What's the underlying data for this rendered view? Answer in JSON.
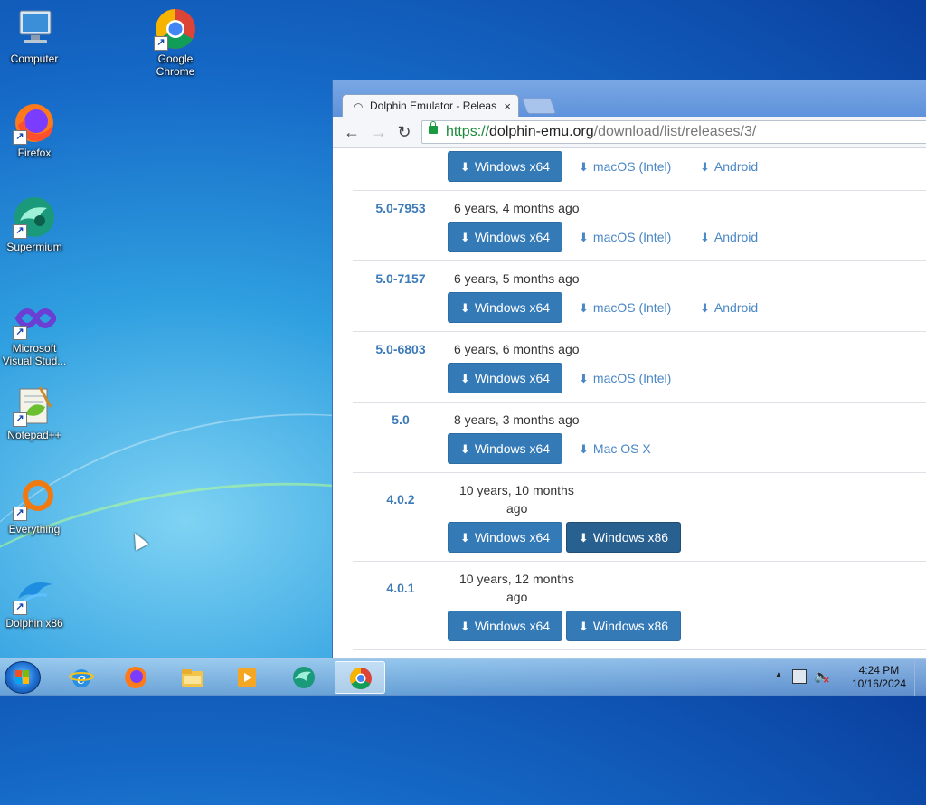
{
  "desktop": {
    "icons": [
      {
        "label": "Computer"
      },
      {
        "label": "Google Chrome"
      },
      {
        "label": "Firefox"
      },
      {
        "label": "Supermium"
      },
      {
        "label": "Microsoft Visual Stud..."
      },
      {
        "label": "Notepad++"
      },
      {
        "label": "Everything"
      },
      {
        "label": "Dolphin x86"
      }
    ]
  },
  "browser": {
    "tab_title": "Dolphin Emulator - Releas",
    "tab_close": "×",
    "url": {
      "scheme": "https://",
      "host": "dolphin-emu.org",
      "path": "/download/list/releases/3/"
    }
  },
  "releases": [
    {
      "version": "",
      "age": "",
      "downloads": [
        "Windows x64",
        "macOS (Intel)",
        "Android"
      ]
    },
    {
      "version": "5.0-7953",
      "age": "6 years, 4 months ago",
      "downloads": [
        "Windows x64",
        "macOS (Intel)",
        "Android"
      ]
    },
    {
      "version": "5.0-7157",
      "age": "6 years, 5 months ago",
      "downloads": [
        "Windows x64",
        "macOS (Intel)",
        "Android"
      ]
    },
    {
      "version": "5.0-6803",
      "age": "6 years, 6 months ago",
      "downloads": [
        "Windows x64",
        "macOS (Intel)"
      ]
    },
    {
      "version": "5.0",
      "age": "8 years, 3 months ago",
      "downloads": [
        "Windows x64",
        "Mac OS X"
      ]
    },
    {
      "version": "4.0.2",
      "age_line1": "10 years, 10 months",
      "age_line2": "ago",
      "downloads": [
        "Windows x64",
        "Windows x86"
      ]
    },
    {
      "version": "4.0.1",
      "age_line1": "10 years, 12 months",
      "age_line2": "ago",
      "downloads": [
        "Windows x64",
        "Windows x86"
      ]
    }
  ],
  "taskbar": {
    "apps": [
      "internet-explorer",
      "firefox",
      "file-explorer",
      "media-player",
      "supermium",
      "chrome"
    ],
    "clock_time": "4:24 PM",
    "clock_date": "10/16/2024"
  },
  "colors": {
    "button": "#337ab7",
    "link": "#4a87c5",
    "version": "#3c7ab8"
  }
}
